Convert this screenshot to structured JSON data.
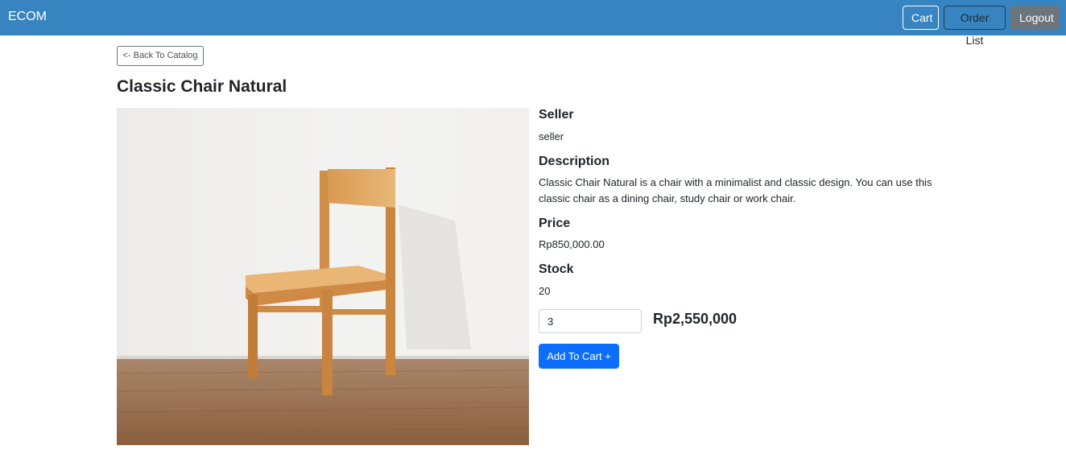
{
  "navbar": {
    "brand": "ECOM",
    "cart_label": "Cart",
    "orders_label": "Order List",
    "logout_label": "Logout"
  },
  "back_label": "<- Back To Catalog",
  "product": {
    "title": "Classic Chair Natural",
    "image_icon": "chair-photo",
    "seller_heading": "Seller",
    "seller": "seller",
    "description_heading": "Description",
    "description": "Classic Chair Natural is a chair with a minimalist and classic design. You can use this classic chair as a dining chair, study chair or work chair.",
    "price_heading": "Price",
    "price": "Rp850,000.00",
    "stock_heading": "Stock",
    "stock": "20"
  },
  "order": {
    "quantity": "3",
    "total": "Rp2,550,000",
    "add_label": "Add To Cart +"
  },
  "colors": {
    "navbar": "#3784c0",
    "primary": "#0d6efd",
    "secondary": "#6c757d"
  }
}
